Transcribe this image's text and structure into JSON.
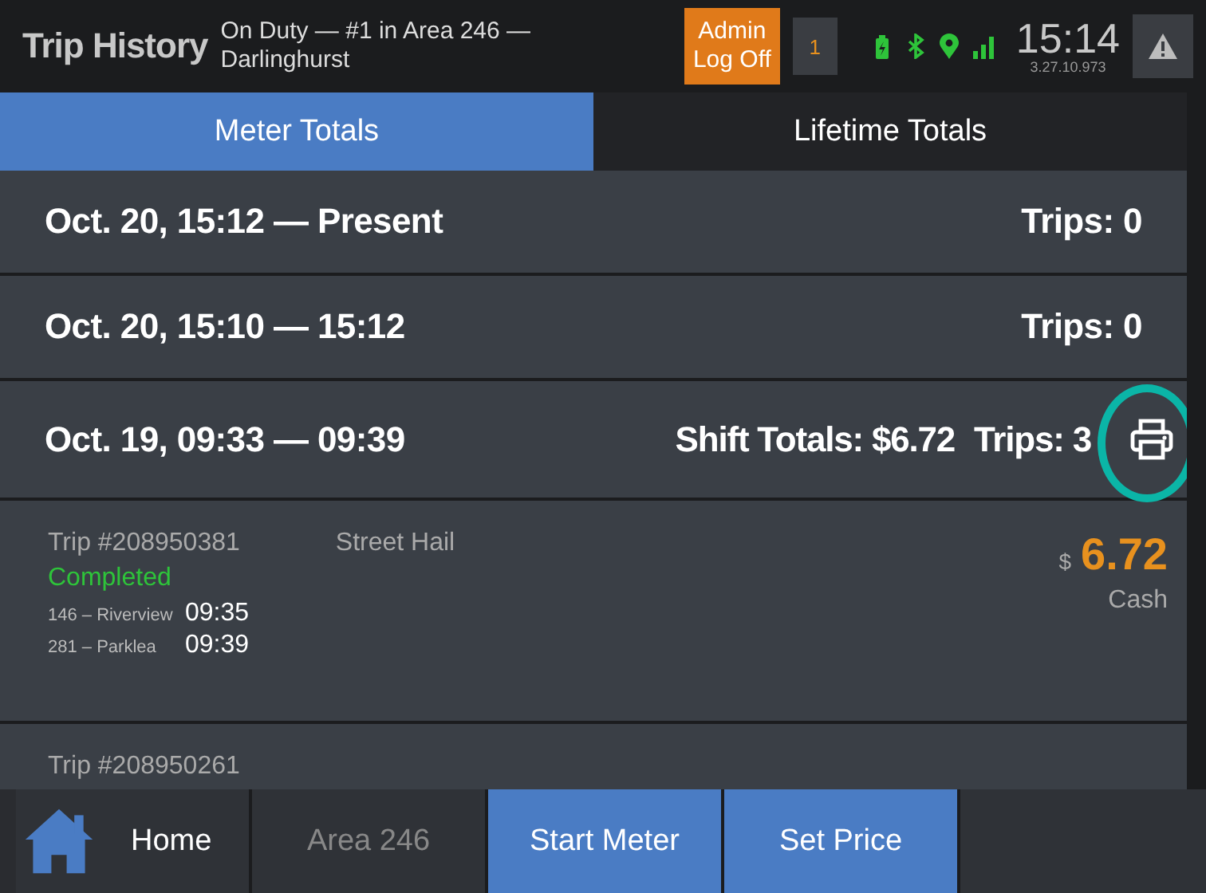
{
  "header": {
    "title": "Trip History",
    "status": "On Duty — #1 in Area 246 — Darlinghurst",
    "admin_button": "Admin Log Off",
    "queue_count": "1",
    "time": "15:14",
    "version": "3.27.10.973"
  },
  "tabs": [
    {
      "label": "Meter Totals",
      "selected": true
    },
    {
      "label": "Lifetime Totals",
      "selected": false
    }
  ],
  "periods": [
    {
      "range": "Oct. 20, 15:12 — Present",
      "trips": "Trips: 0"
    },
    {
      "range": "Oct. 20, 15:10 — 15:12",
      "trips": "Trips: 0"
    },
    {
      "range": "Oct. 19, 09:33 — 09:39",
      "totals": "Shift Totals: $6.72",
      "trips": "Trips: 3",
      "print": true,
      "highlighted": true
    }
  ],
  "trips": [
    {
      "number": "Trip #208950381",
      "type": "Street Hail",
      "status": "Completed",
      "stops": [
        {
          "place": "146 – Riverview",
          "time": "09:35"
        },
        {
          "place": "281 – Parklea",
          "time": "09:39"
        }
      ],
      "currency": "$",
      "amount": "6.72",
      "payment": "Cash"
    },
    {
      "number": "Trip #208950261"
    }
  ],
  "nav": [
    {
      "label": "Home",
      "kind": "home"
    },
    {
      "label": "Area 246",
      "kind": "plain"
    },
    {
      "label": "Start Meter",
      "kind": "action"
    },
    {
      "label": "Set Price",
      "kind": "action"
    }
  ]
}
